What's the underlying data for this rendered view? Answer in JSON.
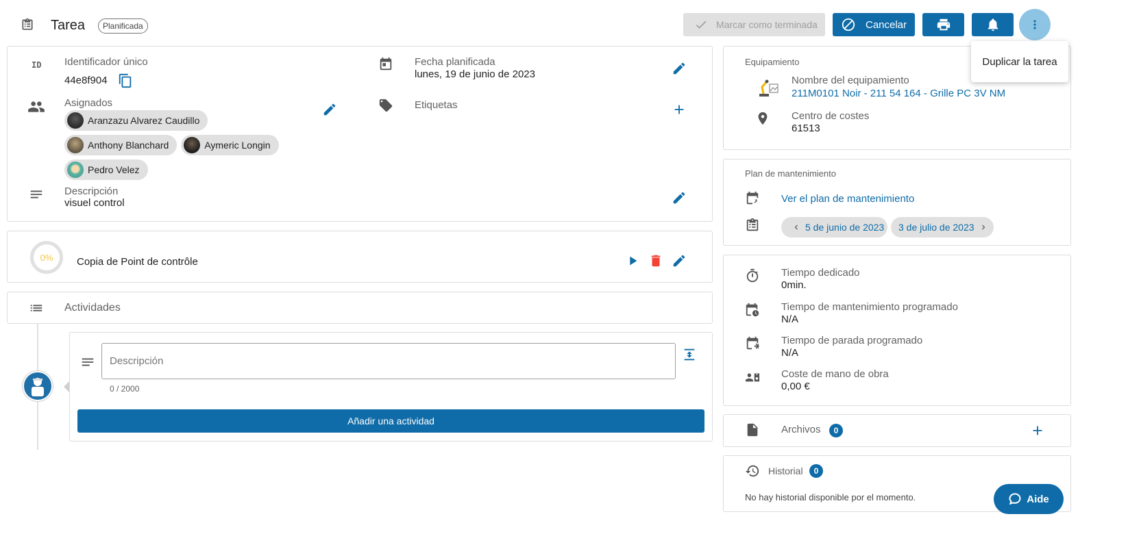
{
  "header": {
    "title": "Tarea",
    "status": "Planificada",
    "mark_done": "Marcar como terminada",
    "cancel": "Cancelar"
  },
  "menu": {
    "duplicate": "Duplicar la tarea"
  },
  "info": {
    "id_label": "Identificador único",
    "id_value": "44e8f904",
    "id_icon_text": "ID",
    "date_label": "Fecha planificada",
    "date_value": "lunes, 19 de junio de 2023",
    "assigned_label": "Asignados",
    "assignees": [
      "Aranzazu Alvarez Caudillo",
      "Anthony Blanchard",
      "Aymeric Longin",
      "Pedro Velez"
    ],
    "tags_label": "Etiquetas",
    "description_label": "Descripción",
    "description_value": "visuel control"
  },
  "checklist": {
    "progress": "0%",
    "name": "Copia de Point de contrôle"
  },
  "activities": {
    "title": "Actividades",
    "placeholder": "Descripción",
    "counter": "0 / 2000",
    "add_button": "Añadir una actividad"
  },
  "equipment": {
    "title": "Equipamiento",
    "name_label": "Nombre del equipamiento",
    "name_value": "211M0101 Noir - 211 54 164 - Grille PC 3V NM",
    "cost_center_label": "Centro de costes",
    "cost_center_value": "61513"
  },
  "plan": {
    "title": "Plan de mantenimiento",
    "link": "Ver el plan de mantenimiento",
    "prev": "5 de junio de 2023",
    "next": "3 de julio de 2023"
  },
  "times": {
    "spent_label": "Tiempo dedicado",
    "spent_value": "0min.",
    "maint_label": "Tiempo de mantenimiento programado",
    "maint_value": "N/A",
    "stop_label": "Tiempo de parada programado",
    "stop_value": "N/A",
    "labor_label": "Coste de mano de obra",
    "labor_value": "0,00 €"
  },
  "files": {
    "label": "Archivos",
    "count": "0"
  },
  "history": {
    "label": "Historial",
    "count": "0",
    "empty": "No hay historial disponible por el momento."
  },
  "help": {
    "label": "Aide"
  },
  "colors": {
    "primary": "#0f6ca8",
    "danger": "#f44336",
    "progress": "#f6c744",
    "chip": "#e0e0e0"
  }
}
